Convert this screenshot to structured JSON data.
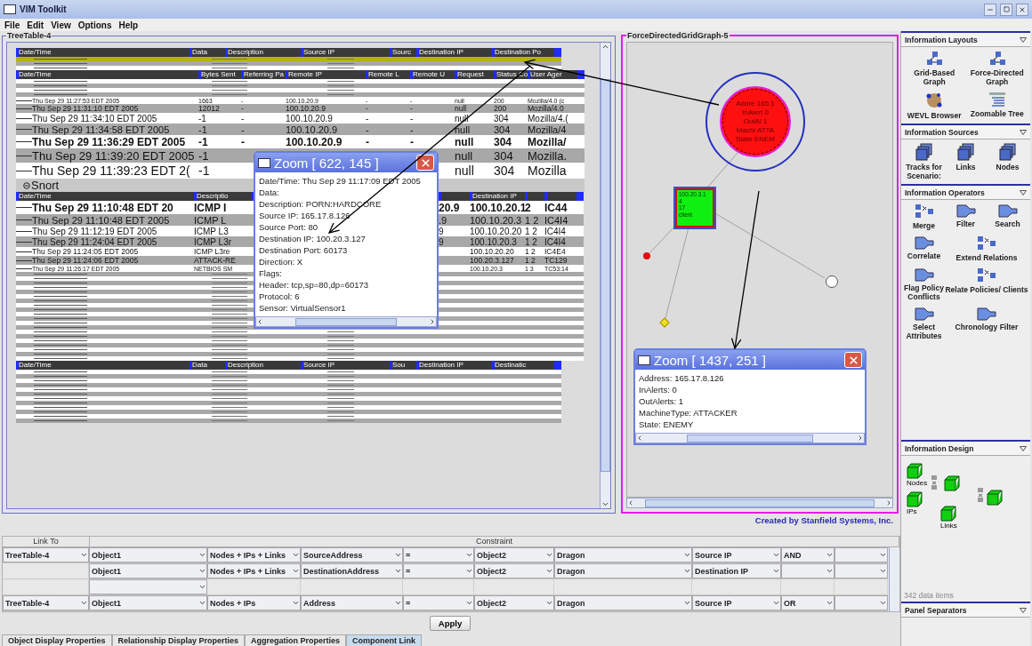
{
  "window": {
    "title": "VIM Toolkit"
  },
  "menu": [
    "File",
    "Edit",
    "View",
    "Options",
    "Help"
  ],
  "treetable": {
    "title": "TreeTable-4",
    "sections": [
      {
        "kind": "table",
        "columns": [
          "Date/Time",
          "Data",
          "Description",
          "Source IP",
          "Sourc",
          "Destination IP",
          "Destination Po"
        ],
        "rows": [
          {
            "kind": "compressed",
            "selected": true
          },
          {
            "kind": "compressed",
            "selected": false
          },
          {
            "kind": "compressed",
            "selected": false
          }
        ]
      },
      {
        "kind": "table",
        "columns": [
          "Date/Time",
          "Bytes Sent",
          "Referring Pa",
          "Remote IP",
          "Remote L",
          "Remote U",
          "Request",
          "Status Co",
          "User Ager"
        ],
        "rows": [
          {
            "kind": "compressed",
            "selected": false
          },
          {
            "kind": "compressed",
            "selected": false
          },
          {
            "kind": "compressed",
            "selected": false
          },
          {
            "kind": "compressed",
            "selected": false
          },
          {
            "kind": "tiny",
            "selected": false,
            "cells": [
              "Thu Sep 29 11:27:53 EDT 2005",
              "1663",
              "-",
              "100.10.20.9",
              "-",
              "-",
              "null",
              "200",
              "Mozilla/4.0 (c"
            ]
          },
          {
            "kind": "small",
            "selected": false,
            "cells": [
              "Thu Sep 29 11:31:10 EDT 2005",
              "12012",
              "-",
              "100.10.20.9",
              "-",
              "-",
              "null",
              "200",
              "Mozilla/4.0"
            ]
          },
          {
            "kind": "medium",
            "selected": false,
            "cells": [
              "Thu Sep 29 11:34:10 EDT 2005",
              "-1",
              "-",
              "100.10.20.9",
              "-",
              "-",
              "null",
              "304",
              "Mozilla/4.("
            ]
          },
          {
            "kind": "large",
            "selected": false,
            "cells": [
              "Thu Sep 29 11:34:58 EDT 2005",
              "-1",
              "-",
              "100.10.20.9",
              "-",
              "-",
              "null",
              "304",
              "Mozilla/4"
            ]
          },
          {
            "kind": "bold-large",
            "selected": false,
            "cells": [
              "Thu Sep 29 11:36:29 EDT 2005",
              "-1",
              "-",
              "100.10.20.9",
              "-",
              "-",
              "null",
              "304",
              "Mozilla/"
            ]
          },
          {
            "kind": "huge",
            "selected": false,
            "cells": [
              "Thu Sep 29 11:39:20 EDT 2005",
              "-1",
              null,
              null,
              null,
              null,
              "null",
              "304",
              "Mozilla."
            ]
          },
          {
            "kind": "giant",
            "selected": false,
            "cells": [
              "Thu Sep 29 11:39:23 EDT 2(",
              "-1",
              null,
              null,
              null,
              null,
              "null",
              "304",
              "Mozilla"
            ]
          },
          {
            "kind": "node",
            "selected": false,
            "cells": [
              "Snort"
            ]
          }
        ]
      },
      {
        "kind": "table",
        "columns": [
          "Date/Time",
          "Descriptio",
          null,
          null,
          "Destination IP",
          null,
          null
        ],
        "rows": [
          {
            "kind": "bold-large",
            "selected": false,
            "cells": [
              "Thu Sep 29 11:10:48 EDT 20",
              "ICMP I",
              null,
              "20.9",
              "100.10.20.1",
              "2",
              "IC44"
            ]
          },
          {
            "kind": "large",
            "selected": false,
            "cells": [
              "Thu Sep 29 11:10:48 EDT 2005",
              "ICMP L",
              null,
              ".9",
              "100.10.20.3",
              "1 2",
              "IC4I4"
            ]
          },
          {
            "kind": "medium",
            "selected": false,
            "cells": [
              "Thu Sep 29 11:12:19 EDT 2005",
              "ICMP L3",
              null,
              "9",
              "100.10.20.20",
              "1 2",
              "IC4I4"
            ]
          },
          {
            "kind": "medium",
            "selected": false,
            "cells": [
              "Thu Sep 29 11:24:04 EDT 2005",
              "ICMP L3r",
              null,
              "9",
              "100.10.20.3",
              "1 2",
              "IC4I4"
            ]
          },
          {
            "kind": "small",
            "selected": false,
            "cells": [
              "Thu Sep 29 11:24:05 EDT 2005",
              "ICMP L3re",
              null,
              null,
              "100.10.20.20",
              "1 2",
              "IC4E4"
            ]
          },
          {
            "kind": "small",
            "selected": false,
            "cells": [
              "Thu Sep 29 11:24:06 EDT 2005",
              "ATTACK-RE",
              null,
              null,
              "100.20.3.127",
              "1 2",
              "TC129"
            ]
          },
          {
            "kind": "tiny",
            "selected": false,
            "cells": [
              "Thu Sep 29 11:26:17 EDT 2005",
              "NETBIOS SM",
              null,
              null,
              "100.10.20.3",
              "1 3",
              "TC53:14"
            ]
          },
          {
            "kind": "compressed",
            "selected": false
          },
          {
            "kind": "compressed",
            "selected": false
          },
          {
            "kind": "compressed",
            "selected": false
          },
          {
            "kind": "compressed",
            "selected": false
          },
          {
            "kind": "compressed",
            "selected": false
          },
          {
            "kind": "compressed",
            "selected": false
          },
          {
            "kind": "compressed",
            "selected": false
          },
          {
            "kind": "compressed",
            "selected": false
          },
          {
            "kind": "compressed",
            "selected": false
          },
          {
            "kind": "compressed",
            "selected": false
          },
          {
            "kind": "compressed",
            "selected": false
          },
          {
            "kind": "compressed",
            "selected": false
          },
          {
            "kind": "compressed",
            "selected": false
          },
          {
            "kind": "compressed",
            "selected": false
          },
          {
            "kind": "compressed",
            "selected": false
          },
          {
            "kind": "compressed",
            "selected": false
          },
          {
            "kind": "compressed",
            "selected": false
          },
          {
            "kind": "compressed",
            "selected": false
          },
          {
            "kind": "compressed",
            "selected": false
          },
          {
            "kind": "compressed",
            "selected": false
          }
        ]
      },
      {
        "kind": "table",
        "columns": [
          "Date/Time",
          "Data",
          "Description",
          "Source IP",
          "Sou",
          "Destination IP",
          "Destinatic"
        ],
        "rows": [
          {
            "kind": "compressed",
            "selected": false
          },
          {
            "kind": "compressed",
            "selected": false
          },
          {
            "kind": "compressed",
            "selected": false
          },
          {
            "kind": "compressed",
            "selected": false
          },
          {
            "kind": "compressed",
            "selected": false
          },
          {
            "kind": "compressed",
            "selected": false
          },
          {
            "kind": "compressed",
            "selected": false
          },
          {
            "kind": "compressed",
            "selected": false
          },
          {
            "kind": "compressed",
            "selected": false
          },
          {
            "kind": "compressed",
            "selected": false
          },
          {
            "kind": "compressed",
            "selected": false
          },
          {
            "kind": "compressed",
            "selected": false
          }
        ]
      }
    ]
  },
  "popups": [
    {
      "title": "Zoom [ 622, 145 ]",
      "lines": [
        "Date/Time: Thu Sep 29 11:17:09 EDT 2005",
        "Data:",
        "Description: PORN:HARDCORE",
        "Source IP: 165.17.8.126",
        "Source Port: 80",
        "Destination IP: 100.20.3.127",
        "Destination Port: 60173",
        "Direction: X",
        "Flags:",
        "Header: tcp,sp=80,dp=60173",
        "Protocol: 6",
        "Sensor: VirtualSensor1"
      ]
    },
    {
      "title": "Zoom [ 1437, 251 ]",
      "lines": [
        "Address: 165.17.8.126",
        "InAlerts: 0",
        "OutAlerts: 1",
        "MachineType: ATTACKER",
        "State: ENEMY"
      ]
    }
  ],
  "graph": {
    "title": "ForceDirectedGridGraph-5",
    "nodes": [
      {
        "kind": "circle",
        "lines": [
          "Addre 165.1",
          "InAlert 0",
          "OutAl 1",
          "Machi ATTA",
          "State ENEM"
        ]
      },
      {
        "kind": "square",
        "lines": [
          "100.20.3.1",
          "4",
          "17",
          "client"
        ]
      },
      {
        "kind": "dot"
      },
      {
        "kind": "diamond"
      },
      {
        "kind": "ring"
      }
    ]
  },
  "credit": "Created by Stanfield Systems, Inc.",
  "link_table": {
    "headers": [
      "Link To",
      "Constraint"
    ],
    "rows": [
      {
        "cells": [
          {
            "kind": "combo",
            "value": "TreeTable-4"
          },
          {
            "kind": "combo",
            "value": "Object1"
          },
          {
            "kind": "combo",
            "value": "Nodes + IPs + Links"
          },
          {
            "kind": "combo",
            "value": "SourceAddress"
          },
          {
            "kind": "combo",
            "value": "="
          },
          {
            "kind": "combo",
            "value": "Object2"
          },
          {
            "kind": "combo",
            "value": "Dragon"
          },
          {
            "kind": "combo",
            "value": "Source IP"
          },
          {
            "kind": "combo",
            "value": "AND"
          },
          {
            "kind": "combo"
          }
        ]
      },
      {
        "cells": [
          {
            "kind": "blank"
          },
          {
            "kind": "combo",
            "value": "Object1"
          },
          {
            "kind": "combo",
            "value": "Nodes + IPs + Links"
          },
          {
            "kind": "combo",
            "value": "DestinationAddress"
          },
          {
            "kind": "combo",
            "value": "="
          },
          {
            "kind": "combo",
            "value": "Object2"
          },
          {
            "kind": "combo",
            "value": "Dragon"
          },
          {
            "kind": "combo",
            "value": "Destination IP"
          },
          {
            "kind": "combo"
          },
          {
            "kind": "combo"
          }
        ]
      },
      {
        "cells": [
          {
            "kind": "blank"
          },
          {
            "kind": "combo"
          },
          {
            "kind": "blank"
          },
          {
            "kind": "blank"
          },
          {
            "kind": "blank"
          },
          {
            "kind": "blank"
          },
          {
            "kind": "blank"
          },
          {
            "kind": "blank"
          },
          {
            "kind": "blank"
          },
          {
            "kind": "blank"
          }
        ]
      },
      {
        "cells": [
          {
            "kind": "combo",
            "value": "TreeTable-4"
          },
          {
            "kind": "combo",
            "value": "Object1"
          },
          {
            "kind": "combo",
            "value": "Nodes + IPs"
          },
          {
            "kind": "combo",
            "value": "Address"
          },
          {
            "kind": "combo",
            "value": "="
          },
          {
            "kind": "combo",
            "value": "Object2"
          },
          {
            "kind": "combo",
            "value": "Dragon"
          },
          {
            "kind": "combo",
            "value": "Source IP"
          },
          {
            "kind": "combo",
            "value": "OR"
          },
          {
            "kind": "combo"
          }
        ]
      }
    ]
  },
  "apply": "Apply",
  "tabs": [
    {
      "label": "Object Display Properties",
      "selected": false
    },
    {
      "label": "Relationship Display Properties",
      "selected": false
    },
    {
      "label": "Aggregation Properties",
      "selected": false
    },
    {
      "label": "Component Link",
      "selected": true
    }
  ],
  "sidebar": {
    "sections": [
      {
        "title": "Information Layouts",
        "kind": "palette",
        "items": [
          {
            "label": "Grid-Based Graph",
            "kind": "graph"
          },
          {
            "label": "Force-Directed Graph",
            "kind": "graph"
          },
          {
            "label": "WEVL Browser",
            "kind": "globe"
          },
          {
            "label": "Zoomable Tree",
            "kind": "tree"
          }
        ]
      },
      {
        "title": "Information Sources",
        "kind": "palette",
        "items": [
          {
            "label": "Tracks for Scenario:",
            "kind": "stack"
          },
          {
            "label": "Links",
            "kind": "stack"
          },
          {
            "label": "Nodes",
            "kind": "stack"
          }
        ]
      },
      {
        "title": "Information Operators",
        "kind": "palette",
        "items": [
          {
            "label": "Merge",
            "kind": "merge"
          },
          {
            "label": "Filter",
            "kind": "pipe"
          },
          {
            "label": "Search",
            "kind": "pipe"
          },
          {
            "label": "Correlate",
            "kind": "pipe"
          },
          {
            "label": "Extend Relations",
            "kind": "merge"
          },
          {
            "label": "Flag Policy Conflicts",
            "kind": "pipe"
          },
          {
            "label": "Relate Policies/ Clients",
            "kind": "merge"
          },
          {
            "label": "Select Attributes",
            "kind": "pipe"
          },
          {
            "label": "Chronology Filter",
            "kind": "pipe"
          }
        ]
      },
      {
        "title": "Information Design",
        "kind": "design",
        "items": [
          {
            "kind": "cube",
            "label": "Nodes"
          },
          {
            "kind": "cube",
            "label": "IPs"
          },
          {
            "kind": "join"
          },
          {
            "kind": "cube"
          },
          {
            "kind": "cube",
            "label": "Links"
          },
          {
            "kind": "join"
          },
          {
            "kind": "cube"
          }
        ],
        "status": "342 data items"
      },
      {
        "title": "Panel Separators",
        "kind": "header"
      }
    ]
  }
}
